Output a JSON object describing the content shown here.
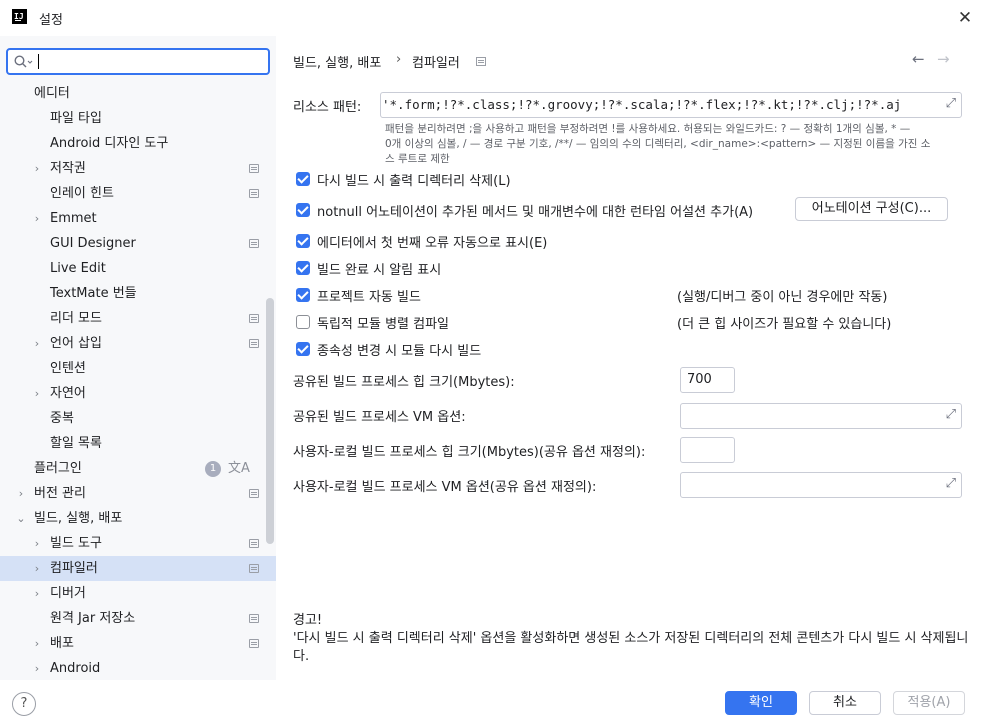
{
  "window": {
    "title": "설정",
    "app_icon_text": "IJ",
    "close": "✕"
  },
  "search": {
    "value": ""
  },
  "sidebar": {
    "items": [
      {
        "label": "에디터",
        "level": 1,
        "chevron": "",
        "pin": false
      },
      {
        "label": "파일 타입",
        "level": 2,
        "chevron": "",
        "pin": false
      },
      {
        "label": "Android 디자인 도구",
        "level": 2,
        "chevron": "",
        "pin": false
      },
      {
        "label": "저작권",
        "level": 2,
        "chevron": "›",
        "pin": true
      },
      {
        "label": "인레이 힌트",
        "level": 2,
        "chevron": "",
        "pin": true
      },
      {
        "label": "Emmet",
        "level": 2,
        "chevron": "›",
        "pin": false
      },
      {
        "label": "GUI Designer",
        "level": 2,
        "chevron": "",
        "pin": true
      },
      {
        "label": "Live Edit",
        "level": 2,
        "chevron": "",
        "pin": false
      },
      {
        "label": "TextMate 번들",
        "level": 2,
        "chevron": "",
        "pin": false
      },
      {
        "label": "리더 모드",
        "level": 2,
        "chevron": "",
        "pin": true
      },
      {
        "label": "언어 삽입",
        "level": 2,
        "chevron": "›",
        "pin": true
      },
      {
        "label": "인텐션",
        "level": 2,
        "chevron": "",
        "pin": false
      },
      {
        "label": "자연어",
        "level": 2,
        "chevron": "›",
        "pin": false
      },
      {
        "label": "중복",
        "level": 2,
        "chevron": "",
        "pin": false
      },
      {
        "label": "할일 목록",
        "level": 2,
        "chevron": "",
        "pin": false
      },
      {
        "label": "플러그인",
        "level": 1,
        "chevron": "",
        "pin": false,
        "badge": "1"
      },
      {
        "label": "버전 관리",
        "level": 1,
        "chevron": "›",
        "pin": true
      },
      {
        "label": "빌드, 실행, 배포",
        "level": 1,
        "chevron": "⌄",
        "pin": false
      },
      {
        "label": "빌드 도구",
        "level": 2,
        "chevron": "›",
        "pin": true
      },
      {
        "label": "컴파일러",
        "level": 2,
        "chevron": "›",
        "pin": true,
        "selected": true
      },
      {
        "label": "디버거",
        "level": 2,
        "chevron": "›",
        "pin": false
      },
      {
        "label": "원격 Jar 저장소",
        "level": 2,
        "chevron": "",
        "pin": true
      },
      {
        "label": "배포",
        "level": 2,
        "chevron": "›",
        "pin": true
      },
      {
        "label": "Android",
        "level": 2,
        "chevron": "›",
        "pin": false
      }
    ]
  },
  "breadcrumb": {
    "parent": "빌드, 실행, 배포",
    "separator": "›",
    "current": "컴파일러"
  },
  "nav": {
    "back": "←",
    "forward": "→"
  },
  "resource_patterns": {
    "label": "리소스 패턴:",
    "value": "'*.form;!?*.class;!?*.groovy;!?*.scala;!?*.flex;!?*.kt;!?*.clj;!?*.aj",
    "hint_line1": "패턴을 분리하려면 ;을 사용하고 패턴을 부정하려면 !를 사용하세요. 허용되는 와일드카드: ? — 정확히 1개의 심볼, * —",
    "hint_line2": "0개 이상의 심볼, / — 경로 구분 기호, /**/ — 임의의 수의 디렉터리, <dir_name>:<pattern> — 지정된 이름을 가진 소",
    "hint_line3": "스 루트로 제한"
  },
  "options": [
    {
      "label": "다시 빌드 시 출력 디렉터리 삭제(L)",
      "checked": true
    },
    {
      "label": "notnull 어노테이션이 추가된 메서드 및 매개변수에 대한 런타임 어설션 추가(A)",
      "checked": true
    },
    {
      "label": "에디터에서 첫 번째 오류 자동으로 표시(E)",
      "checked": true
    },
    {
      "label": "빌드 완료 시 알림 표시",
      "checked": true
    },
    {
      "label": "프로젝트 자동 빌드",
      "checked": true,
      "note": "(실행/디버그 중이 아닌 경우에만 작동)"
    },
    {
      "label": "독립적 모듈 병렬 컴파일",
      "checked": false,
      "note": "(더 큰 힙 사이즈가 필요할 수 있습니다)"
    },
    {
      "label": "종속성 변경 시 모듈 다시 빌드",
      "checked": true
    }
  ],
  "annotation_button": "어노테이션 구성(C)...",
  "heap": {
    "label": "공유된 빌드 프로세스 힙 크기(Mbytes):",
    "value": "700"
  },
  "vm_options": {
    "label": "공유된 빌드 프로세스 VM 옵션:",
    "value": ""
  },
  "user_heap": {
    "label": "사용자-로컬 빌드 프로세스 힙 크기(Mbytes)(공유 옵션 재정의):",
    "value": ""
  },
  "user_vm": {
    "label": "사용자-로컬 빌드 프로세스 VM 옵션(공유 옵션 재정의):",
    "value": ""
  },
  "warning": {
    "title": "경고!",
    "text": "'다시 빌드 시 출력 디렉터리 삭제' 옵션을 활성화하면 생성된 소스가 저장된 디렉터리의 전체 콘텐츠가 다시 빌드 시 삭제됩니다."
  },
  "footer": {
    "help": "?",
    "ok": "확인",
    "cancel": "취소",
    "apply": "적용(A)"
  },
  "colors": {
    "accent": "#3574f0",
    "selection": "#d5e1f6",
    "sidebar_bg": "#f7f8fa"
  },
  "icons": {
    "expand": "⤢",
    "translate": "文A"
  }
}
